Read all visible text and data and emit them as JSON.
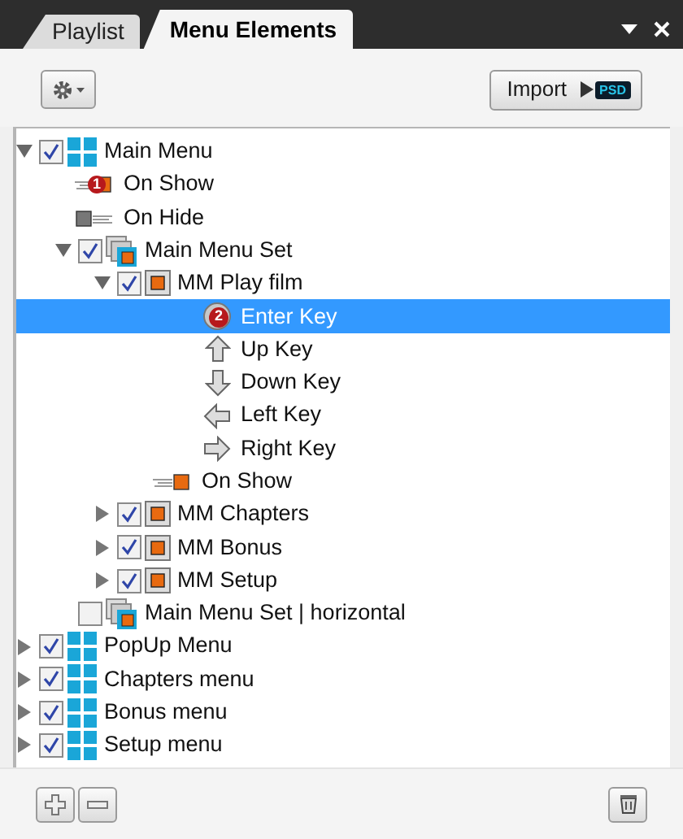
{
  "tabs": [
    {
      "label": "Playlist",
      "selected": false
    },
    {
      "label": "Menu Elements",
      "selected": true
    }
  ],
  "toolbar": {
    "import_button": "Import",
    "psd_badge": "PSD"
  },
  "tree": [
    {
      "kind": "menu",
      "label": "Main Menu",
      "checked": true,
      "expanded": true,
      "selected": false,
      "children": [
        {
          "kind": "show-event",
          "label": "On Show",
          "badge": "1",
          "selected": false
        },
        {
          "kind": "hide-event",
          "label": "On Hide",
          "selected": false
        },
        {
          "kind": "set",
          "label": "Main Menu Set",
          "checked": true,
          "expanded": true,
          "selected": false,
          "children": [
            {
              "kind": "button",
              "label": "MM Play film",
              "checked": true,
              "expanded": true,
              "selected": false,
              "children": [
                {
                  "kind": "enter-key",
                  "label": "Enter Key",
                  "badge": "2",
                  "selected": true
                },
                {
                  "kind": "up-key",
                  "label": "Up Key",
                  "selected": false
                },
                {
                  "kind": "down-key",
                  "label": "Down Key",
                  "selected": false
                },
                {
                  "kind": "left-key",
                  "label": "Left Key",
                  "selected": false
                },
                {
                  "kind": "right-key",
                  "label": "Right Key",
                  "selected": false
                },
                {
                  "kind": "show-event",
                  "label": "On Show",
                  "selected": false
                }
              ]
            },
            {
              "kind": "button",
              "label": "MM Chapters",
              "checked": true,
              "expanded": false,
              "selected": false
            },
            {
              "kind": "button",
              "label": "MM Bonus",
              "checked": true,
              "expanded": false,
              "selected": false
            },
            {
              "kind": "button",
              "label": "MM Setup",
              "checked": true,
              "expanded": false,
              "selected": false
            }
          ]
        },
        {
          "kind": "set",
          "label": "Main Menu Set | horizontal",
          "checked": false,
          "selected": false
        }
      ]
    },
    {
      "kind": "menu",
      "label": "PopUp Menu",
      "checked": true,
      "expanded": false,
      "selected": false
    },
    {
      "kind": "menu",
      "label": "Chapters menu",
      "checked": true,
      "expanded": false,
      "selected": false
    },
    {
      "kind": "menu",
      "label": "Bonus menu",
      "checked": true,
      "expanded": false,
      "selected": false
    },
    {
      "kind": "menu",
      "label": "Setup menu",
      "checked": true,
      "expanded": false,
      "selected": false
    }
  ]
}
